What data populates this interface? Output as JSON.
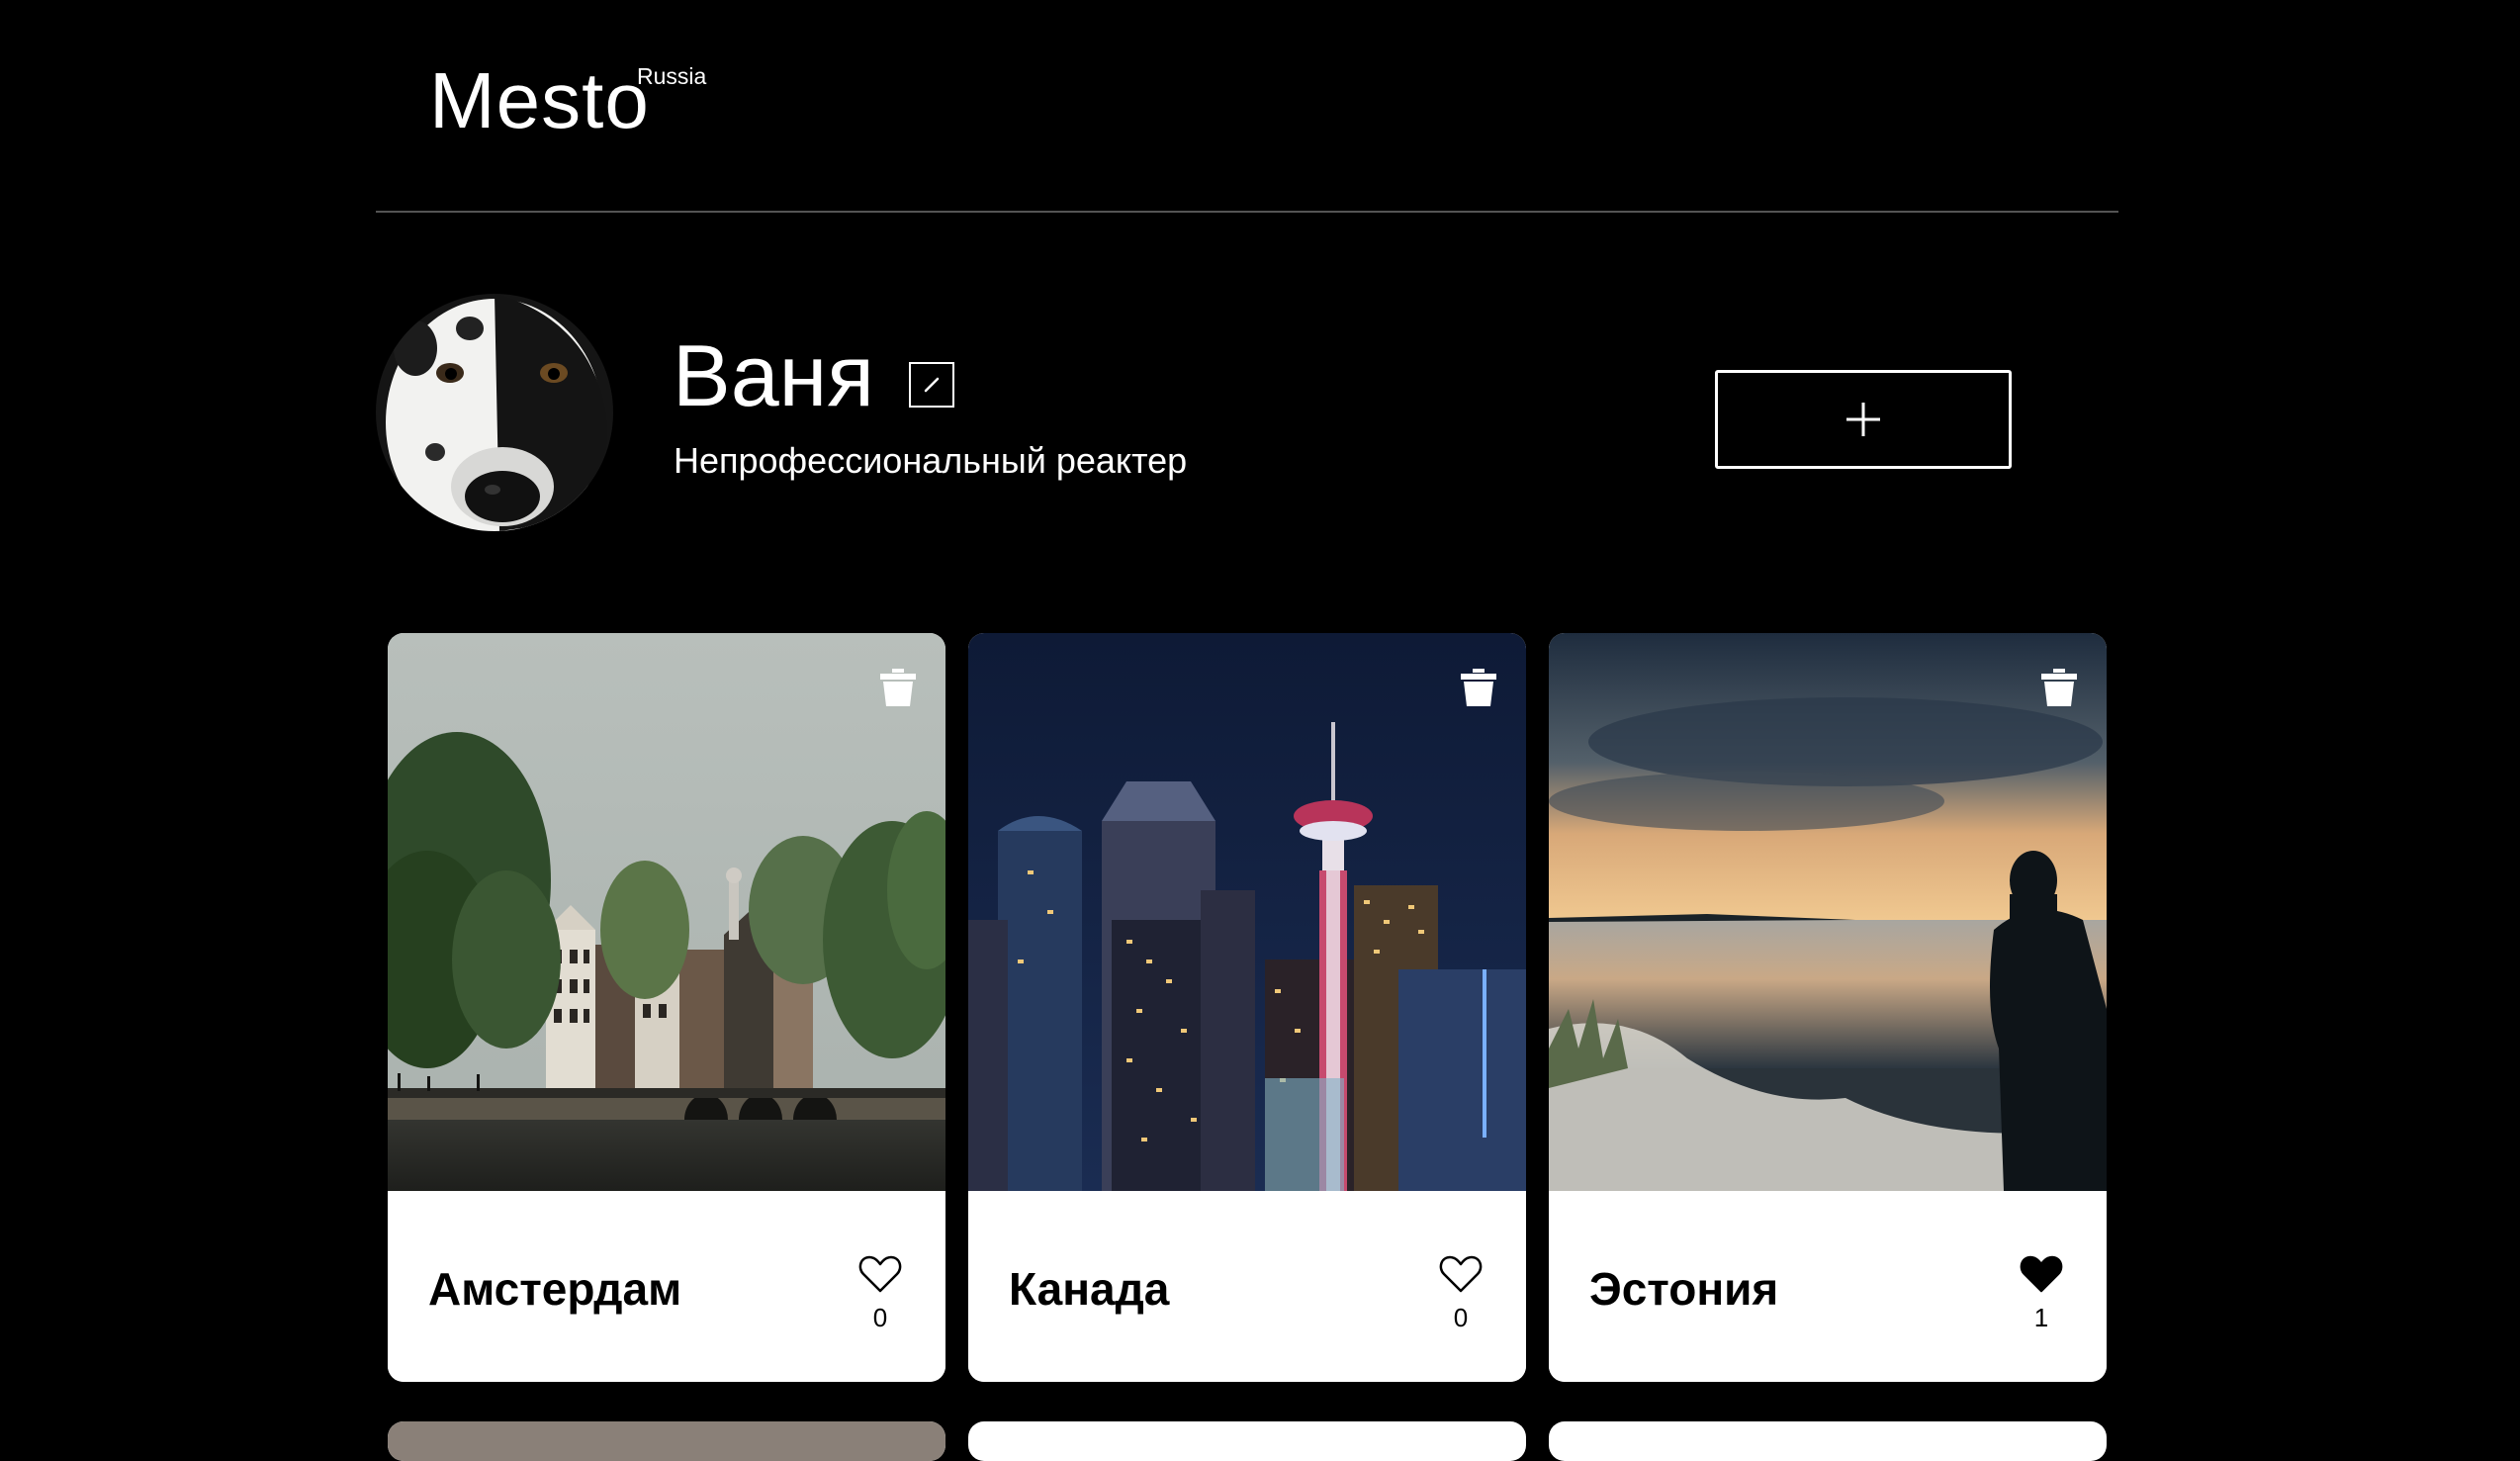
{
  "header": {
    "logo": "Mesto",
    "logo_sup": "Russia"
  },
  "profile": {
    "name": "Ваня",
    "about": "Непрофессиональный реактер",
    "edit_icon": "pencil-icon",
    "add_icon": "plus-icon"
  },
  "cards": [
    {
      "title": "Амстердам",
      "likes": "0",
      "liked": false
    },
    {
      "title": "Канада",
      "likes": "0",
      "liked": false
    },
    {
      "title": "Эстония",
      "likes": "1",
      "liked": true
    }
  ],
  "colors": {
    "background": "#000000",
    "card": "#ffffff",
    "divider": "#545454"
  }
}
